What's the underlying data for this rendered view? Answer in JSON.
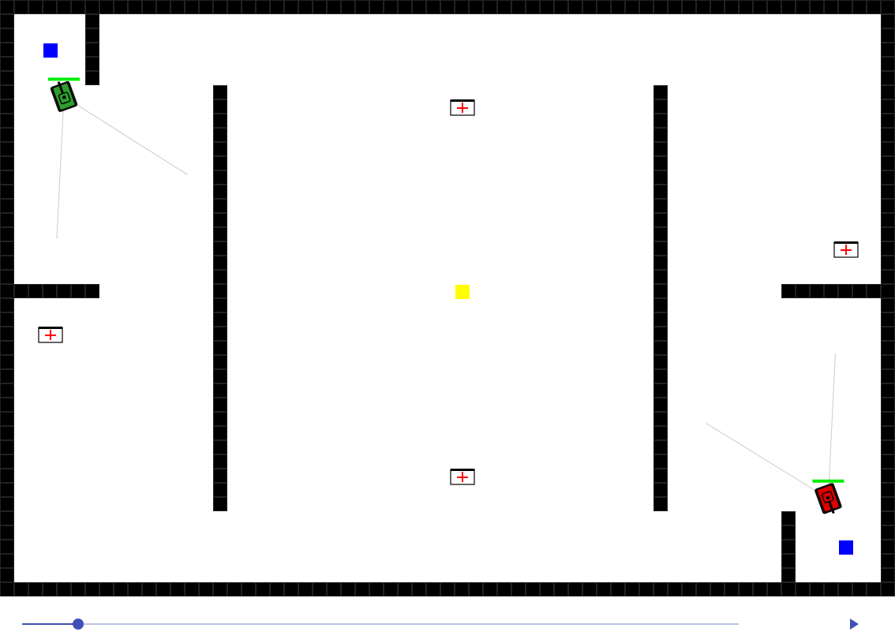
{
  "arena": {
    "grid": {
      "cols": 63,
      "rows": 42
    },
    "colors": {
      "wall": "#000000",
      "wall_grid": "#222222",
      "floor": "#ffffff",
      "sight_line": "#cccccc",
      "health_bar": "#00ee00",
      "health_cross": "#ff0000",
      "flag_blue": "#0000ff",
      "flag_neutral": "#ffff00",
      "tank_green": "#2e9e2e",
      "tank_red": "#dd0000"
    },
    "walls": [
      [
        0,
        0,
        63,
        1
      ],
      [
        0,
        41,
        63,
        1
      ],
      [
        0,
        0,
        1,
        42
      ],
      [
        62,
        0,
        1,
        42
      ],
      [
        6,
        1,
        1,
        5
      ],
      [
        1,
        20,
        6,
        1
      ],
      [
        15,
        6,
        1,
        30
      ],
      [
        46,
        6,
        1,
        30
      ],
      [
        55,
        20,
        7,
        1
      ],
      [
        55,
        36,
        1,
        5
      ]
    ],
    "flags": [
      {
        "name": "blue-flag-green-base",
        "kind": "blue",
        "cell": [
          3,
          3
        ]
      },
      {
        "name": "blue-flag-red-base",
        "kind": "blue",
        "cell": [
          59,
          38
        ]
      },
      {
        "name": "yellow-neutral-flag",
        "kind": "yellow",
        "cell": [
          32,
          20
        ]
      }
    ],
    "medkits": [
      {
        "name": "medkit-top-center",
        "cell": [
          32,
          7
        ]
      },
      {
        "name": "medkit-right",
        "cell": [
          59,
          17
        ]
      },
      {
        "name": "medkit-left",
        "cell": [
          3,
          23
        ]
      },
      {
        "name": "medkit-bottom-center",
        "cell": [
          32,
          33
        ]
      }
    ],
    "tanks": [
      {
        "name": "green-tank",
        "team": "green",
        "cell": [
          4.5,
          6.8
        ],
        "heading_deg": 160,
        "health_fraction": 1.0,
        "sight_ends": [
          [
            13.2,
            12.3
          ],
          [
            4,
            16.8
          ]
        ]
      },
      {
        "name": "red-tank",
        "team": "red",
        "cell": [
          58.3,
          35.1
        ],
        "heading_deg": -20,
        "health_fraction": 1.0,
        "sight_ends": [
          [
            49.7,
            29.8
          ],
          [
            58.8,
            24.9
          ]
        ]
      }
    ]
  },
  "playback": {
    "progress_fraction": 0.078
  },
  "icons": {
    "play": "play-icon",
    "medkit": "medkit-icon",
    "tank": "tank-icon",
    "flag": "flag-icon"
  }
}
